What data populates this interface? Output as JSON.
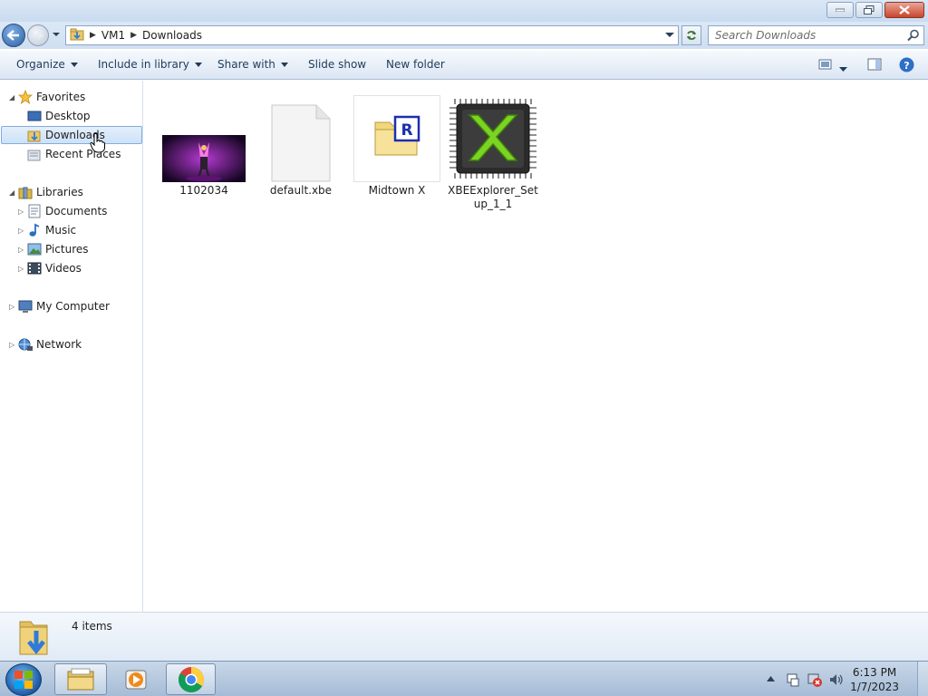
{
  "address": {
    "crumbs": [
      "VM1",
      "Downloads"
    ]
  },
  "search": {
    "placeholder": "Search Downloads"
  },
  "toolbar": {
    "organize": "Organize",
    "include_in_library": "Include in library",
    "share_with": "Share with",
    "slide_show": "Slide show",
    "new_folder": "New folder"
  },
  "nav": {
    "favorites": "Favorites",
    "desktop": "Desktop",
    "downloads": "Downloads",
    "recent_places": "Recent Places",
    "libraries": "Libraries",
    "documents": "Documents",
    "music": "Music",
    "pictures": "Pictures",
    "videos": "Videos",
    "my_computer": "My Computer",
    "network": "Network"
  },
  "files": [
    {
      "name": "1102034",
      "icon": "video-thumbnail-icon"
    },
    {
      "name": "default.xbe",
      "icon": "blank-file-icon"
    },
    {
      "name": "Midtown X",
      "icon": "folder-registry-icon"
    },
    {
      "name": "XBEExplorer_Setup_1_1",
      "icon": "xbox-chip-icon"
    }
  ],
  "details": {
    "item_count": "4 items"
  },
  "taskbar": {
    "time": "6:13 PM",
    "date": "1/7/2023"
  },
  "colors": {
    "selection": "#cde2f8",
    "selection_border": "#84acdd",
    "chrome": "#dce8f6"
  }
}
